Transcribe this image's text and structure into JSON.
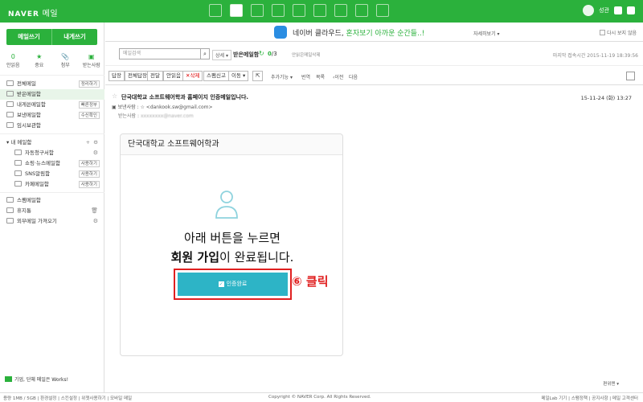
{
  "brand": {
    "name": "NAVER",
    "service": "메일"
  },
  "user": {
    "name": "성관"
  },
  "sidebar": {
    "compose": "메일쓰기",
    "tome": "내게쓰기",
    "quick": [
      {
        "count": "0",
        "label": "안읽음"
      },
      {
        "count": "★",
        "label": "중요"
      },
      {
        "count": "📎",
        "label": "첨부"
      },
      {
        "count": "▣",
        "label": "받는사람"
      }
    ],
    "folders": [
      {
        "label": "전체메일",
        "btn": "정리하기"
      },
      {
        "label": "받은메일함",
        "btn": ""
      },
      {
        "label": "내게쓴메일함",
        "btn": "빠른정부"
      },
      {
        "label": "보낸메일함",
        "btn": "수신확인"
      },
      {
        "label": "임시보관함",
        "btn": ""
      }
    ],
    "mybox_title": "내 메일함",
    "mybox": [
      {
        "label": "자동청구서함",
        "btn": ""
      },
      {
        "label": "쇼핑·뉴스메일함",
        "btn": "사용하기"
      },
      {
        "label": "SNS알림함",
        "btn": "사용하기"
      },
      {
        "label": "카페메일함",
        "btn": "사용하기"
      }
    ],
    "bottom": [
      {
        "label": "스팸메일함"
      },
      {
        "label": "휴지통"
      },
      {
        "label": "외부메일 가져오기"
      }
    ],
    "works": "기업, 단체 메일은 Works!"
  },
  "banner": {
    "text_prefix": "네이버 클라우드, ",
    "text_highlight": "혼자보기 아까운 순간들..!",
    "more": "자세히보기",
    "close": "다시 보지 않음"
  },
  "searchbar": {
    "placeholder": "메일검색",
    "detail": "상세",
    "folder": "받은메일함",
    "unread": "0",
    "total": "3",
    "del_unread": "안읽은메일삭제",
    "last_login": "마지막 접속시간 2015-11-19 18:39:56"
  },
  "toolbar": {
    "reply": "답장",
    "reply_all": "전체답장",
    "forward": "전달",
    "read": "안읽음",
    "delete": "삭제",
    "spam": "스팸신고",
    "move": "이동",
    "more": "추가기능",
    "translate": "번역",
    "list": "목록",
    "prev": "이전",
    "next": "다음"
  },
  "mail": {
    "subject": "단국대학교 소프트웨어학과 홈페이지 인증메일입니다.",
    "date": "15-11-24 (화) 13:27",
    "from_label": "보낸사람",
    "from": "<dankook.sw@gmail.com>",
    "to_label": "받는사람",
    "to": "xxxxxxxx@naver.com"
  },
  "card": {
    "header": "단국대학교 소프트웨어학과",
    "line1": "아래 버튼을 누르면",
    "line2_bold": "회원 가입",
    "line2_rest": "이 완료됩니다.",
    "button": "인증완료"
  },
  "annotation": "⑥ 클릭",
  "lang": "편위맨",
  "footer": {
    "left": "용량 1MB / 5GB | 환경설정 | 스킨설정 | 위젯사용하기 | 모바일 메일",
    "center": "Copyright © NAVER Corp. All Rights Reserved.",
    "right": "메일Lab 기기 | 스팸정책 | 공지사항 | 메일 고객센터"
  },
  "colors": {
    "naver_green": "#2bb13c",
    "confirm_button": "#2db4c6",
    "annotation_red": "#e02020"
  }
}
